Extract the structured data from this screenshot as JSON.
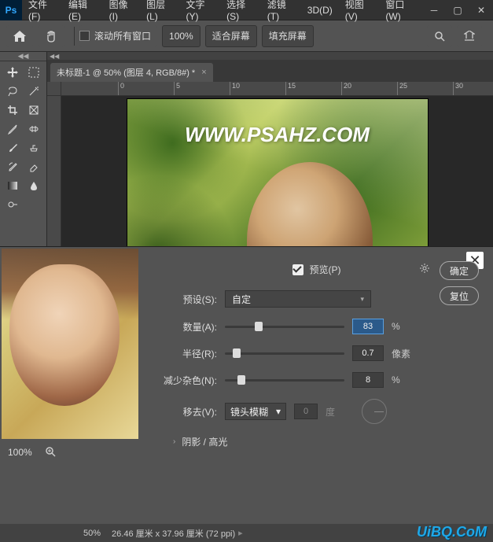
{
  "menubar": {
    "file": "文件(F)",
    "edit": "编辑(E)",
    "image": "图像(I)",
    "layer": "图层(L)",
    "type": "文字(Y)",
    "select": "选择(S)",
    "filter": "滤镜(T)",
    "threeD": "3D(D)",
    "view": "视图(V)",
    "window": "窗口(W)"
  },
  "optionsBar": {
    "scrollAll": "滚动所有窗口",
    "zoom": "100%",
    "fitScreen": "适合屏幕",
    "fillScreen": "填充屏幕"
  },
  "documentTab": {
    "title": "未标题-1 @ 50% (图层 4, RGB/8#) *"
  },
  "rulerTicks": [
    "0",
    "5",
    "10",
    "15",
    "20",
    "25",
    "30"
  ],
  "canvas": {
    "watermark": "WWW.PSAHZ.COM"
  },
  "dialog": {
    "previewLabel": "预览(P)",
    "presetLabel": "预设(S):",
    "presetValue": "自定",
    "amountLabel": "数量(A):",
    "amountValue": "83",
    "amountUnit": "%",
    "radiusLabel": "半径(R):",
    "radiusValue": "0.7",
    "radiusUnit": "像素",
    "noiseLabel": "减少杂色(N):",
    "noiseValue": "8",
    "noiseUnit": "%",
    "removeLabel": "移去(V):",
    "removeValue": "镜头模糊",
    "angleValue": "0",
    "angleUnit": "度",
    "expandLabel": "阴影 / 高光",
    "okLabel": "确定",
    "resetLabel": "复位",
    "previewZoom": "100%"
  },
  "status": {
    "zoom": "50%",
    "dims": "26.46 厘米 x 37.96 厘米 (72 ppi)"
  },
  "branding": {
    "uibq": "UiBQ.CoM"
  },
  "sliderPositions": {
    "amount": "28%",
    "radius": "10%",
    "noise": "14%"
  }
}
